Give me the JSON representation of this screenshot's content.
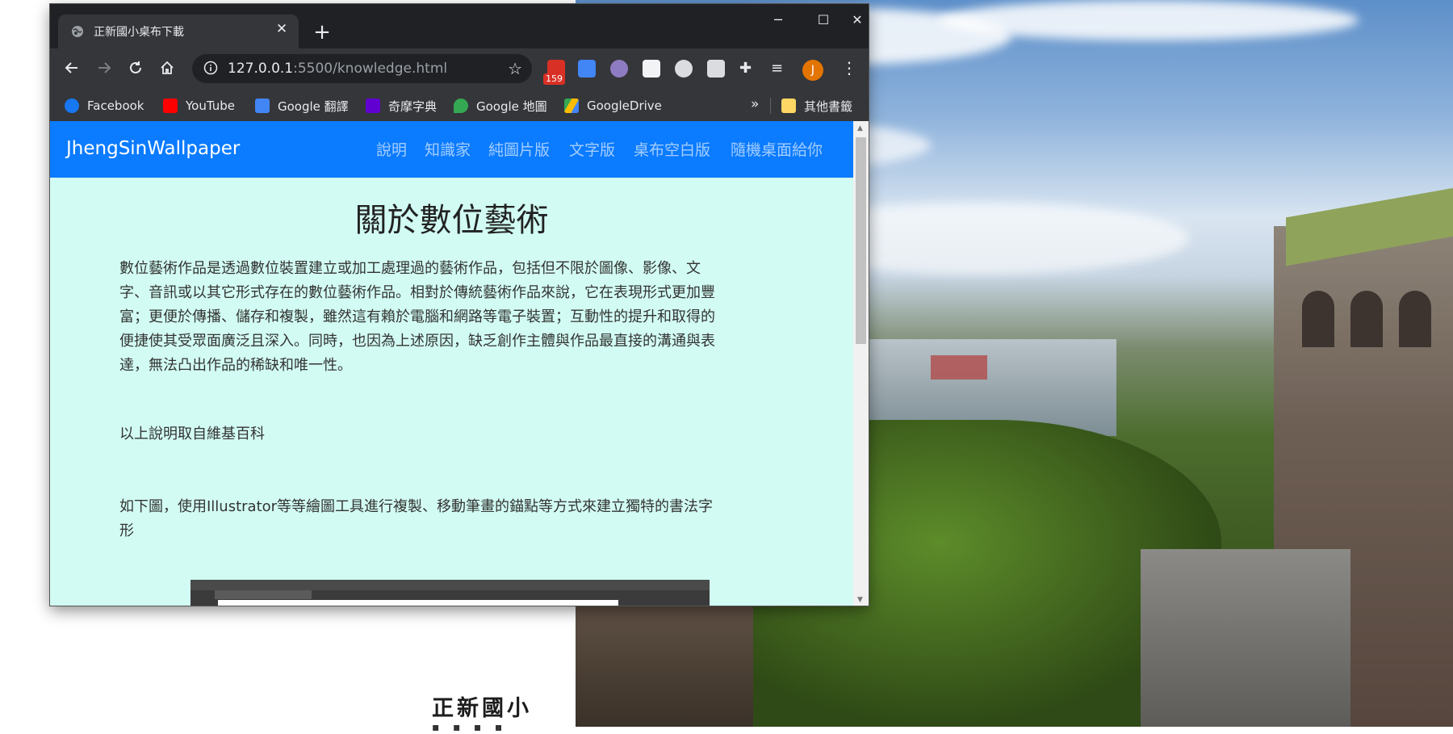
{
  "browser": {
    "tab_title": "正新國小桌布下載",
    "tab_close": "✕",
    "new_tab": "+",
    "window": {
      "minimize": "─",
      "maximize": "☐",
      "close": "✕"
    },
    "url_host": "127.0.0.1",
    "url_rest": ":5500/knowledge.html",
    "mail_badge": "159",
    "avatar_letter": "J",
    "menu": "⋮"
  },
  "bookmarks": {
    "items": [
      {
        "label": "Facebook",
        "icon": "facebook-icon",
        "color": "#1877f2"
      },
      {
        "label": "YouTube",
        "icon": "youtube-icon",
        "color": "#ff0000"
      },
      {
        "label": "Google 翻譯",
        "icon": "google-translate-icon",
        "color": "#4285f4"
      },
      {
        "label": "奇摩字典",
        "icon": "yahoo-icon",
        "color": "#6001d2"
      },
      {
        "label": "Google 地圖",
        "icon": "google-maps-icon",
        "color": "#34a853"
      },
      {
        "label": "GoogleDrive",
        "icon": "google-drive-icon",
        "color": "#fbbc04"
      }
    ],
    "more": "»",
    "other_label": "其他書籤"
  },
  "page": {
    "brand": "JhengSinWallpaper",
    "nav": [
      "說明",
      "知識家",
      "純圖片版",
      "文字版",
      "桌布空白版",
      "隨機桌面給你"
    ],
    "title": "關於數位藝術",
    "para1_lines": [
      "數位藝術作品是透過數位裝置建立或加工處理過的藝術作品，包括但不限於圖像、影像、文",
      "字、音訊或以其它形式存在的數位藝術作品。相對於傳統藝術作品來說，它在表現形式更加豐",
      "富；更便於傳播、儲存和複製，雖然這有賴於電腦和網路等電子裝置；互動性的提升和取得的",
      "便捷使其受眾面廣泛且深入。同時，也因為上述原因，缺乏創作主體與作品最直接的溝通與表",
      "達，無法凸出作品的稀缺和唯一性。"
    ],
    "para2": "以上說明取自維基百科",
    "para3_lines": [
      "如下圖，使用Illustrator等等繪圖工具進行複製、移動筆畫的錨點等方式來建立獨特的書法字",
      "形"
    ]
  },
  "desktop": {
    "school_text": "正新國小"
  },
  "colors": {
    "navbar": "#0b7bff",
    "page_bg": "#d2fcf3",
    "chrome_dark": "#202124",
    "chrome_toolbar": "#35363a"
  }
}
